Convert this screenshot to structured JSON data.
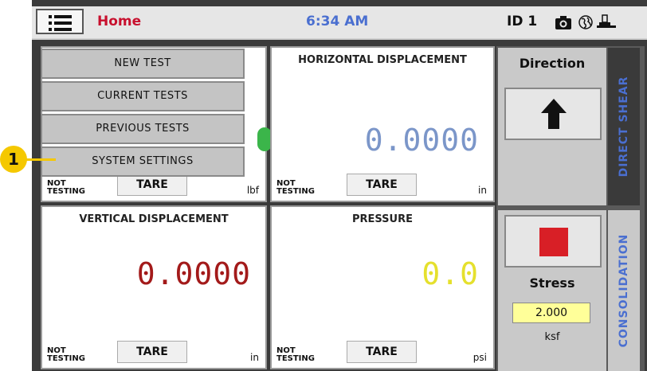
{
  "header": {
    "home": "Home",
    "time": "6:34 AM",
    "id": "ID 1"
  },
  "menu": {
    "items": [
      "NEW TEST",
      "CURRENT TESTS",
      "PREVIOUS TESTS",
      "SYSTEM SETTINGS"
    ]
  },
  "panels": {
    "load": {
      "status_line1": "NOT",
      "status_line2": "TESTING",
      "tare": "TARE",
      "unit": "lbf"
    },
    "horizontal": {
      "title": "HORIZONTAL DISPLACEMENT",
      "value": "0.0000",
      "color": "#7b96c9",
      "status_line1": "NOT",
      "status_line2": "TESTING",
      "tare": "TARE",
      "unit": "in"
    },
    "vertical": {
      "title": "VERTICAL DISPLACEMENT",
      "value": "0.0000",
      "color": "#a31a1a",
      "status_line1": "NOT",
      "status_line2": "TESTING",
      "tare": "TARE",
      "unit": "in"
    },
    "pressure": {
      "title": "PRESSURE",
      "value": "0.0",
      "color": "#e5e02d",
      "status_line1": "NOT",
      "status_line2": "TESTING",
      "tare": "TARE",
      "unit": "psi"
    }
  },
  "direct_shear": {
    "direction_label": "Direction",
    "tab_label": "DIRECT SHEAR"
  },
  "consolidation": {
    "stress_label": "Stress",
    "stress_value": "2.000",
    "stress_unit": "ksf",
    "tab_label": "CONSOLIDATION"
  },
  "callout": {
    "number": "1"
  },
  "icons": [
    "menu-icon",
    "camera-icon",
    "globe-icon",
    "usb-icon",
    "up-arrow-icon",
    "stop-icon"
  ],
  "colors": {
    "home": "#c8102e",
    "time": "#4a6fd0",
    "tab": "#4a6fd0",
    "callout": "#f5c800",
    "stop": "#d81f26"
  }
}
